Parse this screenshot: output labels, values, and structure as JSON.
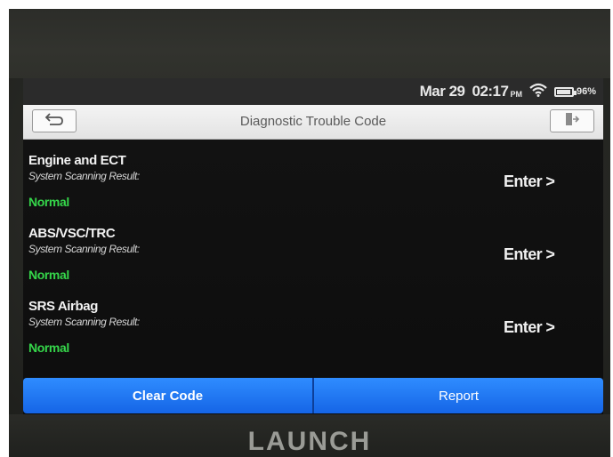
{
  "status": {
    "date": "Mar 29",
    "time": "02:17",
    "ampm": "PM",
    "battery_percent_label": "96%",
    "battery_level": 0.96,
    "icons": [
      "wifi-icon",
      "battery-icon"
    ]
  },
  "header": {
    "title": "Diagnostic Trouble Code",
    "icons": [
      "back-arrow-icon",
      "exit-icon"
    ]
  },
  "systems": [
    {
      "name": "Engine and ECT",
      "label": "System Scanning Result:",
      "result": "Normal",
      "action": "Enter >"
    },
    {
      "name": "ABS/VSC/TRC",
      "label": "System Scanning Result:",
      "result": "Normal",
      "action": "Enter >"
    },
    {
      "name": "SRS Airbag",
      "label": "System Scanning Result:",
      "result": "Normal",
      "action": "Enter >"
    }
  ],
  "footer": {
    "clear_code": "Clear Code",
    "report": "Report"
  },
  "device": {
    "brand": "LAUNCH"
  },
  "colors": {
    "normal_green": "#35d64a",
    "action_blue": "#1e7af5",
    "titlebar_bg": "#ebebeb"
  }
}
